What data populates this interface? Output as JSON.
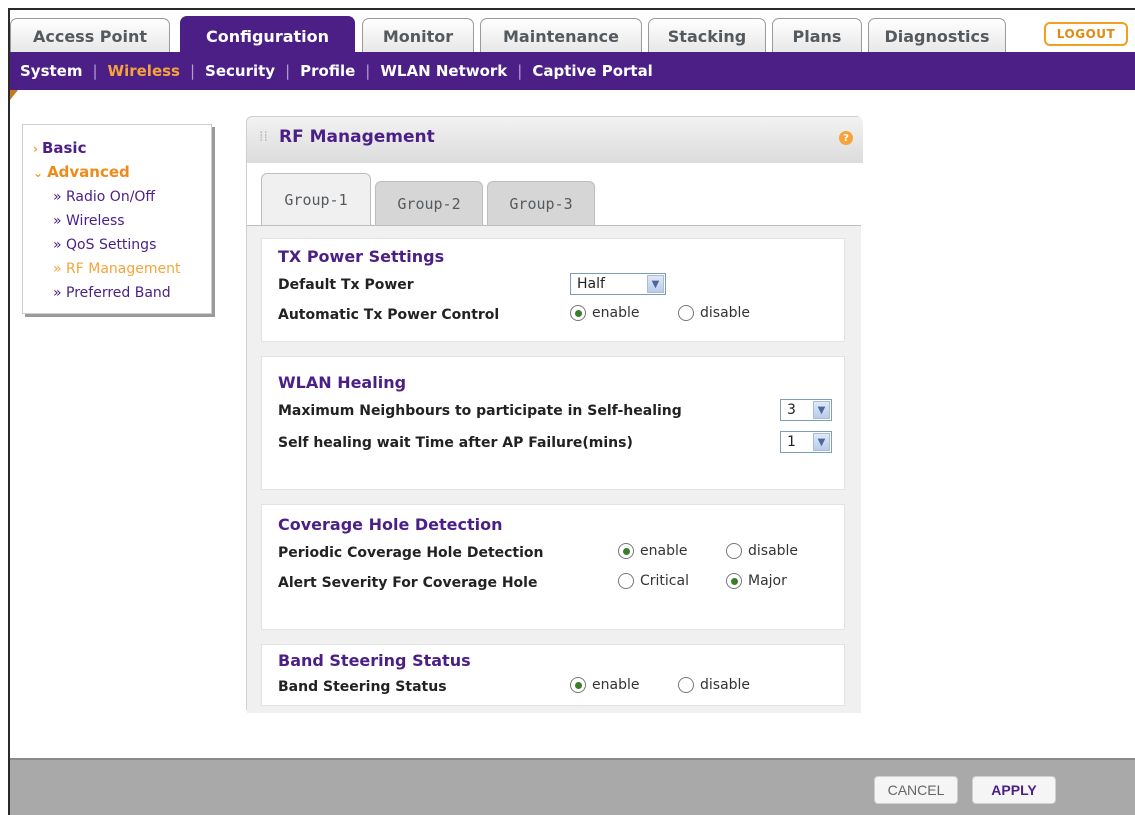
{
  "top_tabs": [
    {
      "label": "Access Point"
    },
    {
      "label": "Configuration"
    },
    {
      "label": "Monitor"
    },
    {
      "label": "Maintenance"
    },
    {
      "label": "Stacking"
    },
    {
      "label": "Plans"
    },
    {
      "label": "Diagnostics"
    }
  ],
  "active_top_tab": "Configuration",
  "logout_label": "LOGOUT",
  "subnav": [
    {
      "label": "System"
    },
    {
      "label": "Wireless"
    },
    {
      "label": "Security"
    },
    {
      "label": "Profile"
    },
    {
      "label": "WLAN Network"
    },
    {
      "label": "Captive Portal"
    }
  ],
  "active_subnav": "Wireless",
  "sidebar": {
    "basic_label": "Basic",
    "advanced_label": "Advanced",
    "items": [
      {
        "label": "» Radio On/Off"
      },
      {
        "label": "» Wireless"
      },
      {
        "label": "» QoS Settings"
      },
      {
        "label": "» RF Management"
      },
      {
        "label": "» Preferred Band"
      }
    ],
    "active_item": "» RF Management"
  },
  "panel": {
    "title": "RF Management",
    "help_icon": "?",
    "group_tabs": [
      {
        "label": "Group-1"
      },
      {
        "label": "Group-2"
      },
      {
        "label": "Group-3"
      }
    ],
    "active_group": "Group-1"
  },
  "tx_power": {
    "title": "TX Power Settings",
    "default_label": "Default Tx Power",
    "default_value": "Half",
    "auto_label": "Automatic Tx Power Control",
    "enable_label": "enable",
    "disable_label": "disable",
    "auto_selected": "enable"
  },
  "wlan_healing": {
    "title": "WLAN Healing",
    "max_label": "Maximum Neighbours to participate in Self-healing",
    "max_value": "3",
    "wait_label": "Self healing wait Time after AP Failure(mins)",
    "wait_value": "1"
  },
  "coverage_hole": {
    "title": "Coverage Hole Detection",
    "periodic_label": "Periodic Coverage Hole Detection",
    "enable_label": "enable",
    "disable_label": "disable",
    "periodic_selected": "enable",
    "alert_label": "Alert Severity For Coverage Hole",
    "critical_label": "Critical",
    "major_label": "Major",
    "alert_selected": "Major"
  },
  "band_steering": {
    "title": "Band Steering Status",
    "label": "Band Steering Status",
    "enable_label": "enable",
    "disable_label": "disable",
    "selected": "enable"
  },
  "buttons": {
    "cancel": "CANCEL",
    "apply": "APPLY"
  }
}
